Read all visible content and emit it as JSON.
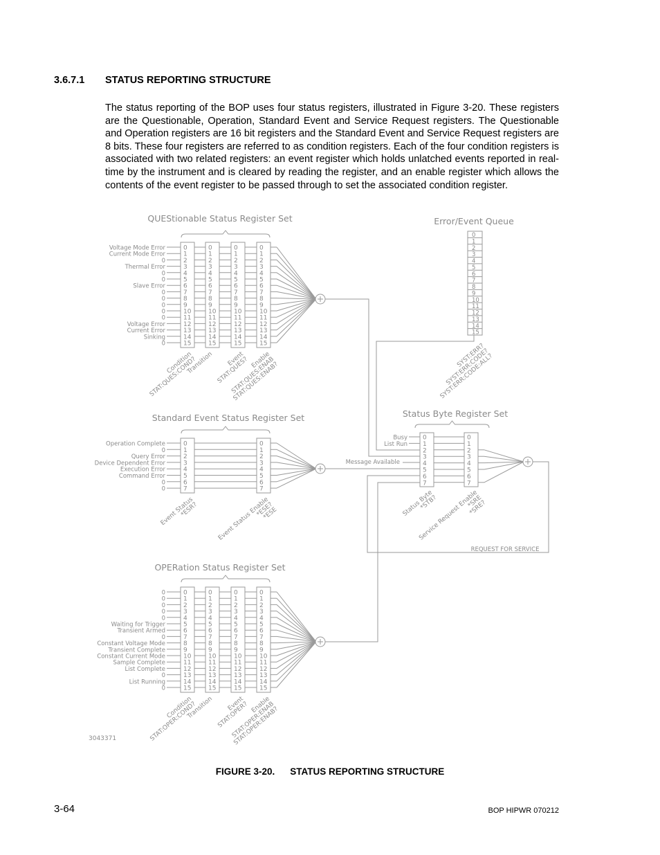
{
  "section": {
    "number": "3.6.7.1",
    "title": "STATUS REPORTING STRUCTURE",
    "body": "The status reporting of the BOP uses four status registers, illustrated in Figure 3-20. These registers are the Questionable, Operation, Standard Event and Service Request registers. The Questionable and Operation registers are 16 bit registers and the Standard Event and Service Request registers are 8 bits. These four registers are referred to as condition registers. Each of the four condition registers is associated with two related registers: an event register which holds unlatched events reported in real-time by the instrument and is cleared by reading the register, and an enable register which allows the contents of the event register to be passed through to set the associated condition register."
  },
  "diagram": {
    "questionable": {
      "title": "QUEStionable Status Register Set",
      "bits": [
        "Voltage Mode Error",
        "Current Mode Error",
        "0",
        "Thermal Error",
        "0",
        "0",
        "Slave Error",
        "0",
        "0",
        "0",
        "0",
        "0",
        "Voltage Error",
        "Current Error",
        "Sinking",
        "0"
      ],
      "columns": [
        {
          "lines": [
            "Condition",
            "STAT:QUES:COND?"
          ]
        },
        {
          "lines": [
            "Transition"
          ]
        },
        {
          "lines": [
            "Event",
            "STAT:QUES?"
          ]
        },
        {
          "lines": [
            "Enable",
            "STAT:QUES:ENAB",
            "STAT:QUES:ENAB?"
          ]
        }
      ]
    },
    "error_queue": {
      "title": "Error/Event Queue",
      "entries": [
        "0",
        "1",
        "2",
        "3",
        "4",
        "5",
        "6",
        "7",
        "8",
        "9",
        "10",
        "11",
        "12",
        "13",
        "14",
        "15"
      ],
      "commands": [
        "SYST:ERR?",
        "SYST:ERR:CODE?",
        "SYST:ERR:CODE:ALL?"
      ]
    },
    "standard_event": {
      "title": "Standard Event Status Register Set",
      "bits": [
        "Operation Complete",
        "0",
        "Query Error",
        "Device Dependent Error",
        "Execution Error",
        "Command Error",
        "0",
        "0"
      ],
      "columns": [
        {
          "lines": [
            "Event Status",
            "*ESR?"
          ]
        },
        {
          "lines": [
            "Event Status Enable",
            "*ESE?",
            "*ESE"
          ]
        }
      ],
      "output_label": "Message Available"
    },
    "status_byte": {
      "title": "Status Byte Register Set",
      "bits": [
        "Busy",
        "List Run"
      ],
      "columns": [
        {
          "lines": [
            "Status Byte",
            "*STB?"
          ]
        },
        {
          "lines": [
            "Service Request Enable",
            "*SRE",
            "*SRE?"
          ]
        }
      ],
      "rqs_label": "REQUEST FOR SERVICE"
    },
    "operation": {
      "title": "OPERation Status Register Set",
      "bits": [
        "0",
        "0",
        "0",
        "0",
        "0",
        "Waiting for Trigger",
        "Transient Armed",
        "0",
        "Constant Voltage Mode",
        "Transient Complete",
        "Constant Current Mode",
        "Sample Complete",
        "List Complete",
        "0",
        "List Running",
        "0"
      ],
      "columns": [
        {
          "lines": [
            "Condition",
            "STAT:OPER:COND?"
          ]
        },
        {
          "lines": [
            "Transition"
          ]
        },
        {
          "lines": [
            "Event",
            "STAT:OPER?"
          ]
        },
        {
          "lines": [
            "Enable",
            "STAT:OPER:ENAB",
            "STAT:OPER:ENAB?"
          ]
        }
      ]
    },
    "drawing_id": "3043371"
  },
  "figure": {
    "label": "FIGURE 3-20.",
    "title": "STATUS REPORTING STRUCTURE"
  },
  "footer": {
    "page_number": "3-64",
    "document_id": "BOP HIPWR 070212"
  }
}
